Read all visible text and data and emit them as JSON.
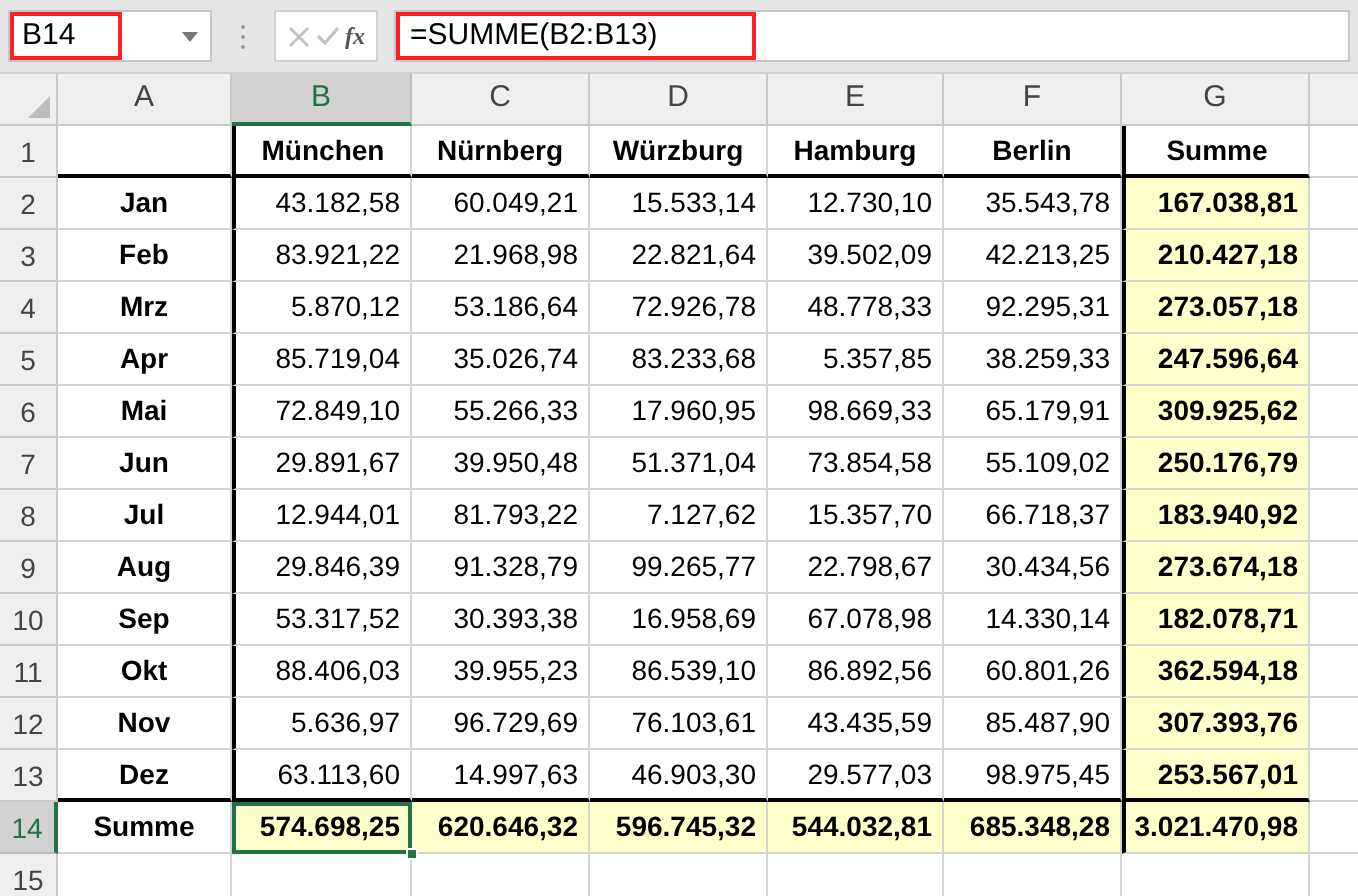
{
  "name_box": {
    "value": "B14",
    "highlighted": true
  },
  "formula_bar": {
    "function_label": "fx",
    "value": "=SUMME(B2:B13)",
    "highlighted": true
  },
  "columns": [
    {
      "label": "A",
      "selected": false
    },
    {
      "label": "B",
      "selected": true
    },
    {
      "label": "C",
      "selected": false
    },
    {
      "label": "D",
      "selected": false
    },
    {
      "label": "E",
      "selected": false
    },
    {
      "label": "F",
      "selected": false
    },
    {
      "label": "G",
      "selected": false
    }
  ],
  "header_row": {
    "number": "1",
    "selected": false,
    "labels": [
      "München",
      "Nürnberg",
      "Würzburg",
      "Hamburg",
      "Berlin",
      "Summe"
    ]
  },
  "rows": [
    {
      "number": "2",
      "selected": false,
      "label": "Jan",
      "values": [
        "43.182,58",
        "60.049,21",
        "15.533,14",
        "12.730,10",
        "35.543,78"
      ],
      "total": "167.038,81"
    },
    {
      "number": "3",
      "selected": false,
      "label": "Feb",
      "values": [
        "83.921,22",
        "21.968,98",
        "22.821,64",
        "39.502,09",
        "42.213,25"
      ],
      "total": "210.427,18"
    },
    {
      "number": "4",
      "selected": false,
      "label": "Mrz",
      "values": [
        "5.870,12",
        "53.186,64",
        "72.926,78",
        "48.778,33",
        "92.295,31"
      ],
      "total": "273.057,18"
    },
    {
      "number": "5",
      "selected": false,
      "label": "Apr",
      "values": [
        "85.719,04",
        "35.026,74",
        "83.233,68",
        "5.357,85",
        "38.259,33"
      ],
      "total": "247.596,64"
    },
    {
      "number": "6",
      "selected": false,
      "label": "Mai",
      "values": [
        "72.849,10",
        "55.266,33",
        "17.960,95",
        "98.669,33",
        "65.179,91"
      ],
      "total": "309.925,62"
    },
    {
      "number": "7",
      "selected": false,
      "label": "Jun",
      "values": [
        "29.891,67",
        "39.950,48",
        "51.371,04",
        "73.854,58",
        "55.109,02"
      ],
      "total": "250.176,79"
    },
    {
      "number": "8",
      "selected": false,
      "label": "Jul",
      "values": [
        "12.944,01",
        "81.793,22",
        "7.127,62",
        "15.357,70",
        "66.718,37"
      ],
      "total": "183.940,92"
    },
    {
      "number": "9",
      "selected": false,
      "label": "Aug",
      "values": [
        "29.846,39",
        "91.328,79",
        "99.265,77",
        "22.798,67",
        "30.434,56"
      ],
      "total": "273.674,18"
    },
    {
      "number": "10",
      "selected": false,
      "label": "Sep",
      "values": [
        "53.317,52",
        "30.393,38",
        "16.958,69",
        "67.078,98",
        "14.330,14"
      ],
      "total": "182.078,71"
    },
    {
      "number": "11",
      "selected": false,
      "label": "Okt",
      "values": [
        "88.406,03",
        "39.955,23",
        "86.539,10",
        "86.892,56",
        "60.801,26"
      ],
      "total": "362.594,18"
    },
    {
      "number": "12",
      "selected": false,
      "label": "Nov",
      "values": [
        "5.636,97",
        "96.729,69",
        "76.103,61",
        "43.435,59",
        "85.487,90"
      ],
      "total": "307.393,76"
    },
    {
      "number": "13",
      "selected": false,
      "label": "Dez",
      "values": [
        "63.113,60",
        "14.997,63",
        "46.903,30",
        "29.577,03",
        "98.975,45"
      ],
      "total": "253.567,01"
    }
  ],
  "total_row": {
    "number": "14",
    "selected": true,
    "label": "Summe",
    "values": [
      "574.698,25",
      "620.646,32",
      "596.745,32",
      "544.032,81",
      "685.348,28"
    ],
    "total": "3.021.470,98"
  },
  "empty_rows": [
    {
      "number": "15",
      "selected": false
    }
  ]
}
